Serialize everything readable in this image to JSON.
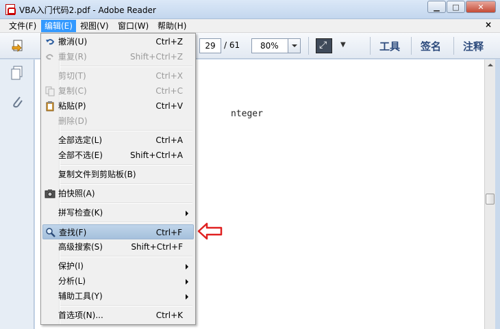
{
  "window": {
    "title": "VBA入门代码2.pdf - Adobe Reader",
    "minimize_label": "▁",
    "maximize_label": "□",
    "close_label": "✕"
  },
  "menubar": {
    "items": [
      "文件(F)",
      "编辑(E)",
      "视图(V)",
      "窗口(W)",
      "帮助(H)"
    ],
    "close_label": "×"
  },
  "toolbar": {
    "page_current": "29",
    "page_total": "/ 61",
    "zoom": "80%",
    "tools_label": "工具",
    "sign_label": "签名",
    "comment_label": "注释"
  },
  "document": {
    "visible_text": "nteger"
  },
  "edit_menu": {
    "items": [
      {
        "label": "撤消(U)",
        "shortcut": "Ctrl+Z",
        "disabled": false,
        "icon": "undo-icon"
      },
      {
        "label": "重复(R)",
        "shortcut": "Shift+Ctrl+Z",
        "disabled": true,
        "icon": "redo-icon"
      },
      {
        "label": "剪切(T)",
        "shortcut": "Ctrl+X",
        "disabled": true,
        "icon": ""
      },
      {
        "label": "复制(C)",
        "shortcut": "Ctrl+C",
        "disabled": true,
        "icon": "copy-icon"
      },
      {
        "label": "粘贴(P)",
        "shortcut": "Ctrl+V",
        "disabled": false,
        "icon": "paste-icon"
      },
      {
        "label": "删除(D)",
        "shortcut": "",
        "disabled": true,
        "icon": ""
      },
      {
        "label": "全部选定(L)",
        "shortcut": "Ctrl+A",
        "disabled": false,
        "icon": ""
      },
      {
        "label": "全部不选(E)",
        "shortcut": "Shift+Ctrl+A",
        "disabled": false,
        "icon": ""
      },
      {
        "label": "复制文件到剪贴板(B)",
        "shortcut": "",
        "disabled": false,
        "icon": ""
      },
      {
        "label": "拍快照(A)",
        "shortcut": "",
        "disabled": false,
        "icon": "camera-icon"
      },
      {
        "label": "拼写检查(K)",
        "shortcut": "",
        "disabled": false,
        "icon": "",
        "submenu": true
      },
      {
        "label": "查找(F)",
        "shortcut": "Ctrl+F",
        "disabled": false,
        "icon": "search-icon",
        "highlighted": true
      },
      {
        "label": "高级搜索(S)",
        "shortcut": "Shift+Ctrl+F",
        "disabled": false,
        "icon": ""
      },
      {
        "label": "保护(I)",
        "shortcut": "",
        "disabled": false,
        "icon": "",
        "submenu": true
      },
      {
        "label": "分析(L)",
        "shortcut": "",
        "disabled": false,
        "icon": "",
        "submenu": true
      },
      {
        "label": "辅助工具(Y)",
        "shortcut": "",
        "disabled": false,
        "icon": "",
        "submenu": true
      },
      {
        "label": "首选项(N)...",
        "shortcut": "Ctrl+K",
        "disabled": false,
        "icon": ""
      }
    ]
  },
  "colors": {
    "menu_highlight": "#3399ff",
    "arrow_red": "#e02020",
    "toolbar_label": "#2c4a7c"
  }
}
